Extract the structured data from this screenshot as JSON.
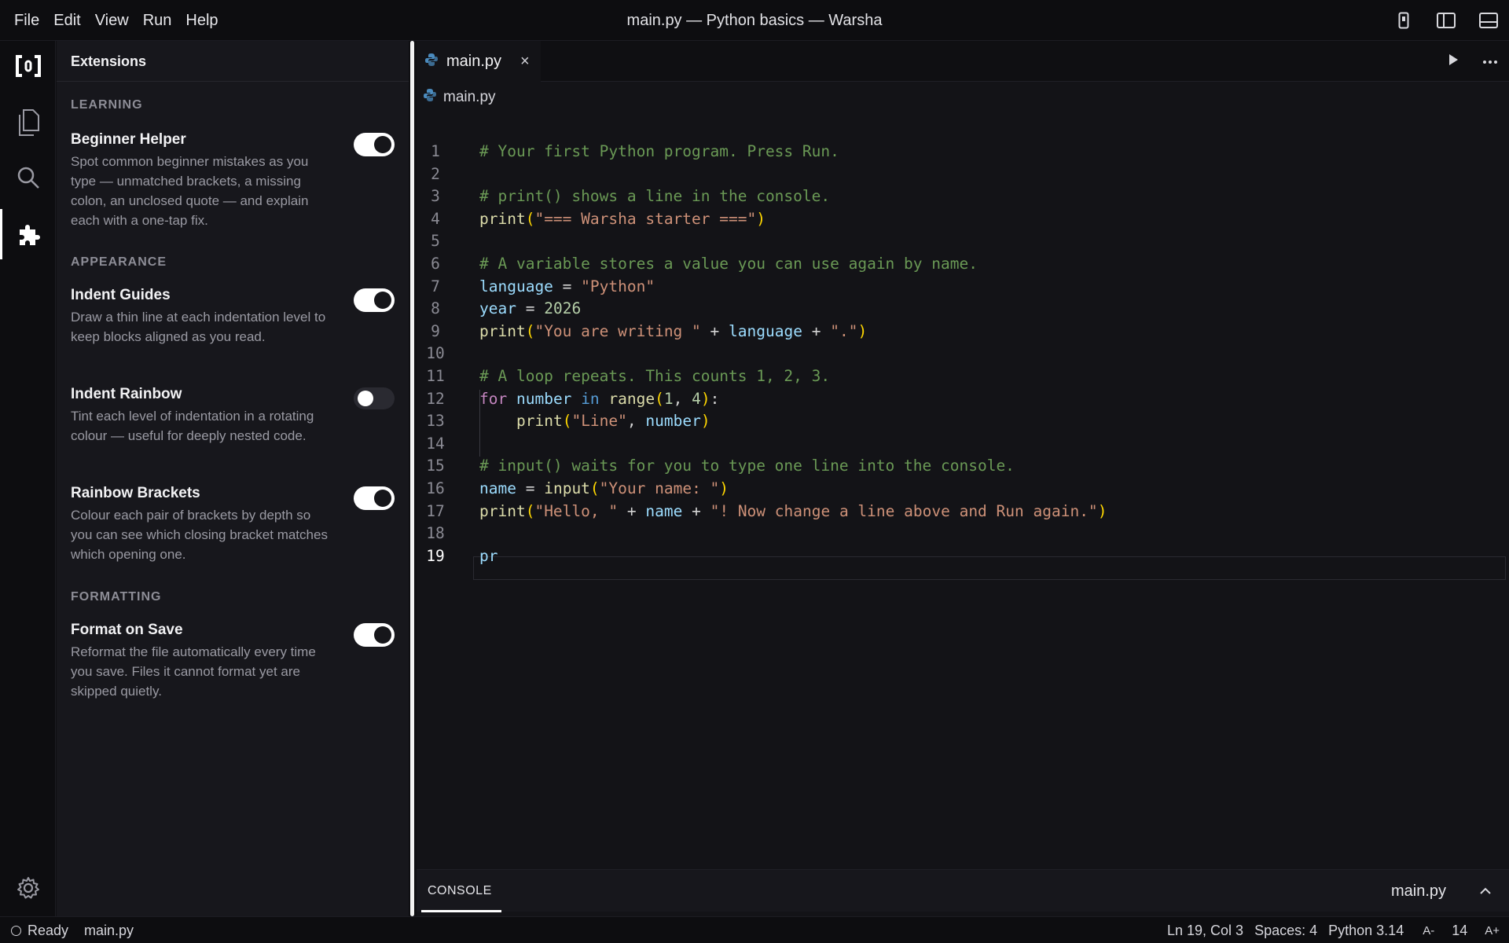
{
  "menu": [
    "File",
    "Edit",
    "View",
    "Run",
    "Help"
  ],
  "window_title": "main.py — Python basics — Warsha",
  "extensions": {
    "title": "Extensions",
    "sections": [
      {
        "name": "LEARNING"
      },
      {
        "name": "APPEARANCE"
      },
      {
        "name": "FORMATTING"
      }
    ],
    "items": [
      {
        "name": "Beginner Helper",
        "enabled": true,
        "description": "Spot common beginner mistakes as you type — unmatched brackets, a missing colon, an unclosed quote — and explain each with a one-tap fix."
      },
      {
        "name": "Indent Guides",
        "enabled": true,
        "description": "Draw a thin line at each indentation level to keep blocks aligned as you read."
      },
      {
        "name": "Indent Rainbow",
        "enabled": false,
        "description": "Tint each level of indentation in a rotating colour — useful for deeply nested code."
      },
      {
        "name": "Rainbow Brackets",
        "enabled": true,
        "description": "Colour each pair of brackets by depth so you can see which closing bracket matches which opening one."
      },
      {
        "name": "Format on Save",
        "enabled": true,
        "description": "Reformat the file automatically every time you save. Files it cannot format yet are skipped quietly."
      }
    ]
  },
  "editor": {
    "tab_label": "main.py",
    "tab_close": "×",
    "breadcrumb": "main.py",
    "current_line": 19,
    "line_numbers": [
      "1",
      "2",
      "3",
      "4",
      "5",
      "6",
      "7",
      "8",
      "9",
      "10",
      "11",
      "12",
      "13",
      "14",
      "15",
      "16",
      "17",
      "18",
      "19"
    ],
    "code_lines": [
      "# Your first Python program. Press Run.",
      "",
      "# print() shows a line in the console.",
      "print(\"=== Warsha starter ===\")",
      "",
      "# A variable stores a value you can use again by name.",
      "language = \"Python\"",
      "year = 2026",
      "print(\"You are writing \" + language + \".\")",
      "",
      "# A loop repeats. This counts 1, 2, 3.",
      "for number in range(1, 4):",
      "    print(\"Line\", number)",
      "",
      "# input() waits for you to type one line into the console.",
      "name = input(\"Your name: \")",
      "print(\"Hello, \" + name + \"! Now change a line above and Run again.\")",
      "",
      "pr"
    ]
  },
  "console": {
    "tab_label": "CONSOLE",
    "file_label": "main.py"
  },
  "status": {
    "state": "Ready",
    "file": "main.py",
    "cursor": "Ln 19, Col 3",
    "spaces": "Spaces: 4",
    "language": "Python 3.14",
    "font_decrease": "A-",
    "font_size": "14",
    "font_increase": "A+"
  },
  "colors": {
    "background": "#131317",
    "panel": "#17171c",
    "comment": "#6a9955",
    "string": "#ce9178",
    "function": "#dcdcaa",
    "variable": "#9cdcfe",
    "keyword": "#c586c0",
    "bracket": "#ffd700",
    "python_icon": "#4b8bbe"
  },
  "icons": [
    "logo-icon",
    "files-icon",
    "search-icon",
    "extensions-icon",
    "settings-icon",
    "device-icon",
    "sidebar-toggle-icon",
    "panel-toggle-icon",
    "run-icon",
    "more-icon",
    "python-file-icon",
    "chevron-up-icon"
  ]
}
